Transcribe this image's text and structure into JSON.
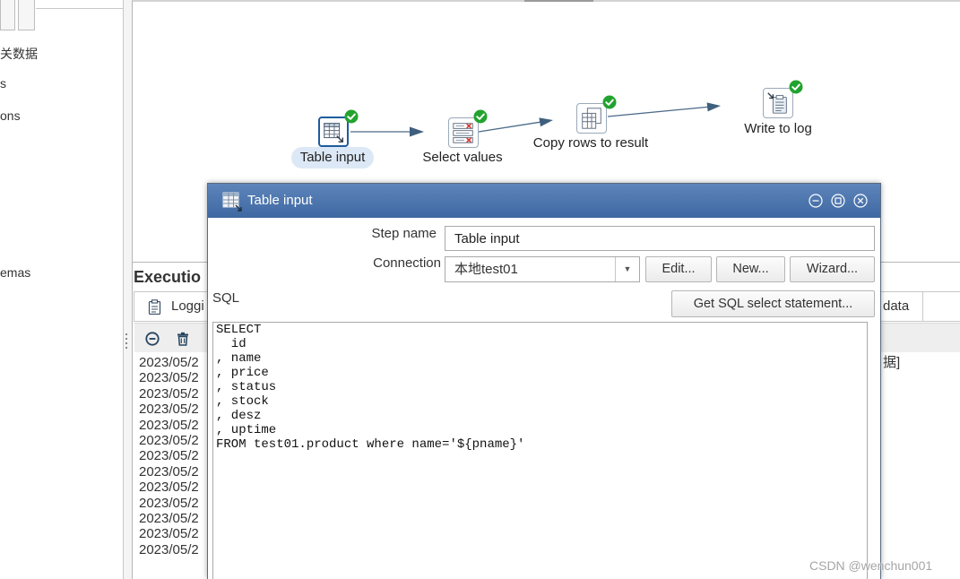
{
  "left_panel": {
    "items": [
      "关数据",
      "s",
      "ons",
      "emas"
    ]
  },
  "canvas": {
    "steps": [
      {
        "label": "Table input",
        "icon": "table-input-icon",
        "status_icon": "check-circle-icon",
        "selected": true
      },
      {
        "label": "Select values",
        "icon": "select-values-icon",
        "status_icon": "check-circle-icon",
        "selected": false
      },
      {
        "label": "Copy rows to result",
        "icon": "copy-rows-icon",
        "status_icon": "check-circle-icon",
        "selected": false
      },
      {
        "label": "Write to log",
        "icon": "write-to-log-icon",
        "status_icon": "check-circle-icon",
        "selected": false
      }
    ]
  },
  "execution": {
    "title": "Executio",
    "tabs": [
      {
        "label": "Loggi",
        "icon": "clipboard-icon"
      },
      {
        "label": "data"
      }
    ],
    "toolbar_icons": [
      "minus-circle-icon",
      "trash-icon"
    ],
    "log_lines": [
      "2023/05/2",
      "2023/05/2",
      "2023/05/2",
      "2023/05/2",
      "2023/05/2",
      "2023/05/2",
      "2023/05/2",
      "2023/05/2",
      "2023/05/2",
      "2023/05/2",
      "2023/05/2",
      "2023/05/2",
      "2023/05/2"
    ],
    "preview_fragment": "据]"
  },
  "dialog": {
    "title": "Table input",
    "icon": "table-input-icon",
    "window_controls": [
      "minimize-icon",
      "maximize-icon",
      "close-icon"
    ],
    "step_name": {
      "label": "Step name",
      "value": "Table input"
    },
    "connection": {
      "label": "Connection",
      "value": "本地test01",
      "edit_button": "Edit...",
      "new_button": "New...",
      "wizard_button": "Wizard..."
    },
    "sql": {
      "label": "SQL",
      "get_statement_button": "Get SQL select statement...",
      "text": "SELECT\n  id\n, name\n, price\n, status\n, stock\n, desz\n, uptime\nFROM test01.product where name='${pname}'"
    }
  },
  "watermark": "CSDN @wenchun001",
  "colors": {
    "title_bar": "#4a74ad",
    "selected_step_border": "#1e5c9e",
    "success_check": "#22a32f",
    "hop_arrow": "#4a6a87",
    "selected_label_bg": "#dce8f5"
  }
}
